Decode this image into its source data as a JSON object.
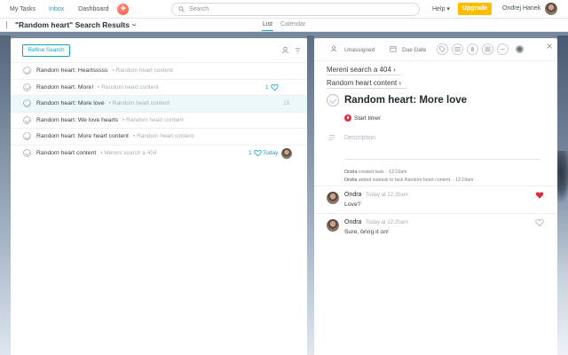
{
  "app": {
    "nav": [
      "My Tasks",
      "Inbox",
      "Dashboard"
    ],
    "search_placeholder": "Search",
    "help": "Help",
    "upgrade": "Upgrade",
    "user_name": "Ondrej Hanek"
  },
  "header": {
    "title": "\"Random heart\" Search Results",
    "tabs": [
      "List",
      "Calendar"
    ],
    "active_tab": "List"
  },
  "results": {
    "refine_label": "Refine Search",
    "tasks": [
      {
        "name": "Random heart: Heartsssss",
        "project": "Random heart content",
        "likes": "",
        "liked": false,
        "due": "",
        "assigned": false
      },
      {
        "name": "Random heart: More!",
        "project": "Random heart content",
        "likes": "1",
        "liked": false,
        "due": "",
        "assigned": false
      },
      {
        "name": "Random heart: More love",
        "project": "Random heart content",
        "likes": "15",
        "liked": false,
        "due": "",
        "assigned": false
      },
      {
        "name": "Random heart: We love hearts",
        "project": "Random heart content",
        "likes": "",
        "liked": false,
        "due": "",
        "assigned": false
      },
      {
        "name": "Random heart: More heart content",
        "project": "Random heart content",
        "likes": "",
        "liked": false,
        "due": "",
        "assigned": false
      },
      {
        "name": "Random heart content",
        "project": "Mereni search a 404",
        "likes": "1",
        "liked": false,
        "due": "Today",
        "assigned": true
      }
    ]
  },
  "detail": {
    "assignee": "Unassigned",
    "due_date": "Due Date",
    "project_breadcrumb": "Mereni search a 404",
    "parent_breadcrumb": "Random heart content",
    "title": "Random heart: More love",
    "timer_label": "Start timer",
    "description_placeholder": "Description",
    "activity": [
      {
        "actor": "Ondra",
        "action": "created task.",
        "time": "12:19am"
      },
      {
        "actor": "Ondra",
        "action": "added subtask to task Random heart content.",
        "time": "12:19am"
      }
    ],
    "comments": [
      {
        "author": "Ondra",
        "time": "Today at 12:20am",
        "text": "Love?",
        "liked": true
      },
      {
        "author": "Ondra",
        "time": "Today at 12:20am",
        "text": "Sure, bring it on!",
        "liked": false
      }
    ]
  },
  "colors": {
    "accent": "#16a3c6",
    "upgrade": "#fcbd01",
    "heart_liked": "#e8253a",
    "timer": "#e2324a"
  },
  "icons": {
    "search": "search-icon",
    "add": "add-icon",
    "chevron": "chevron-down-icon",
    "heart": "heart-icon",
    "close": "close-icon",
    "people": "people-icon",
    "sort": "sort-icon"
  }
}
